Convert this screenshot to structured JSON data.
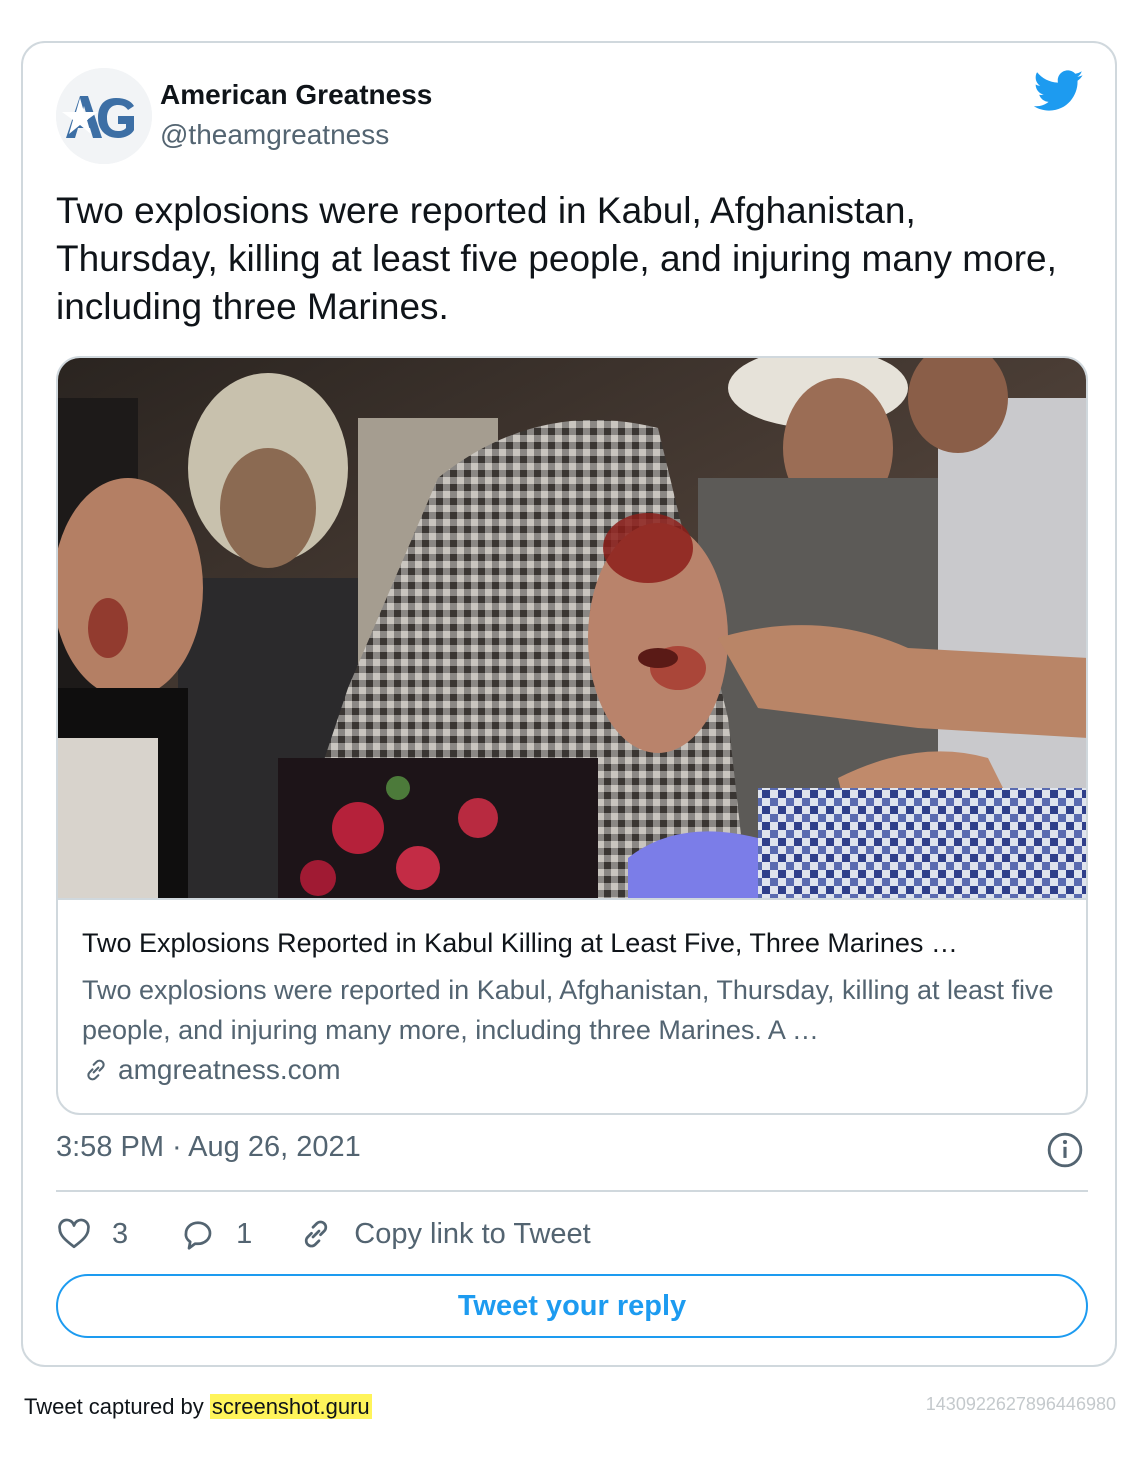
{
  "author": {
    "name": "American Greatness",
    "handle": "@theamgreatness",
    "avatar_icon": "ag-logo-avatar"
  },
  "tweet": {
    "text": "Two explosions were reported in Kabul, Afghanistan, Thursday, killing at least five people, and injuring many more, including three Marines.",
    "timestamp": "3:58 PM · Aug 26, 2021"
  },
  "link_card": {
    "title": "Two Explosions Reported in Kabul Killing at Least Five, Three Marines …",
    "description": "Two explosions were reported in Kabul, Afghanistan, Thursday, killing at least five people, and injuring many more, including three Marines. A …",
    "domain": "amgreatness.com",
    "image_icon": "news-photo"
  },
  "actions": {
    "likes": "3",
    "replies": "1",
    "copy_link": "Copy link to Tweet"
  },
  "reply_button": "Tweet your reply",
  "footer": {
    "captured_prefix": "Tweet captured by ",
    "captured_site": "screenshot.guru",
    "tweet_id": "1430922627896446980"
  },
  "colors": {
    "accent": "#1d9bf0",
    "text_secondary": "#536471",
    "border": "#d0d8dd"
  }
}
